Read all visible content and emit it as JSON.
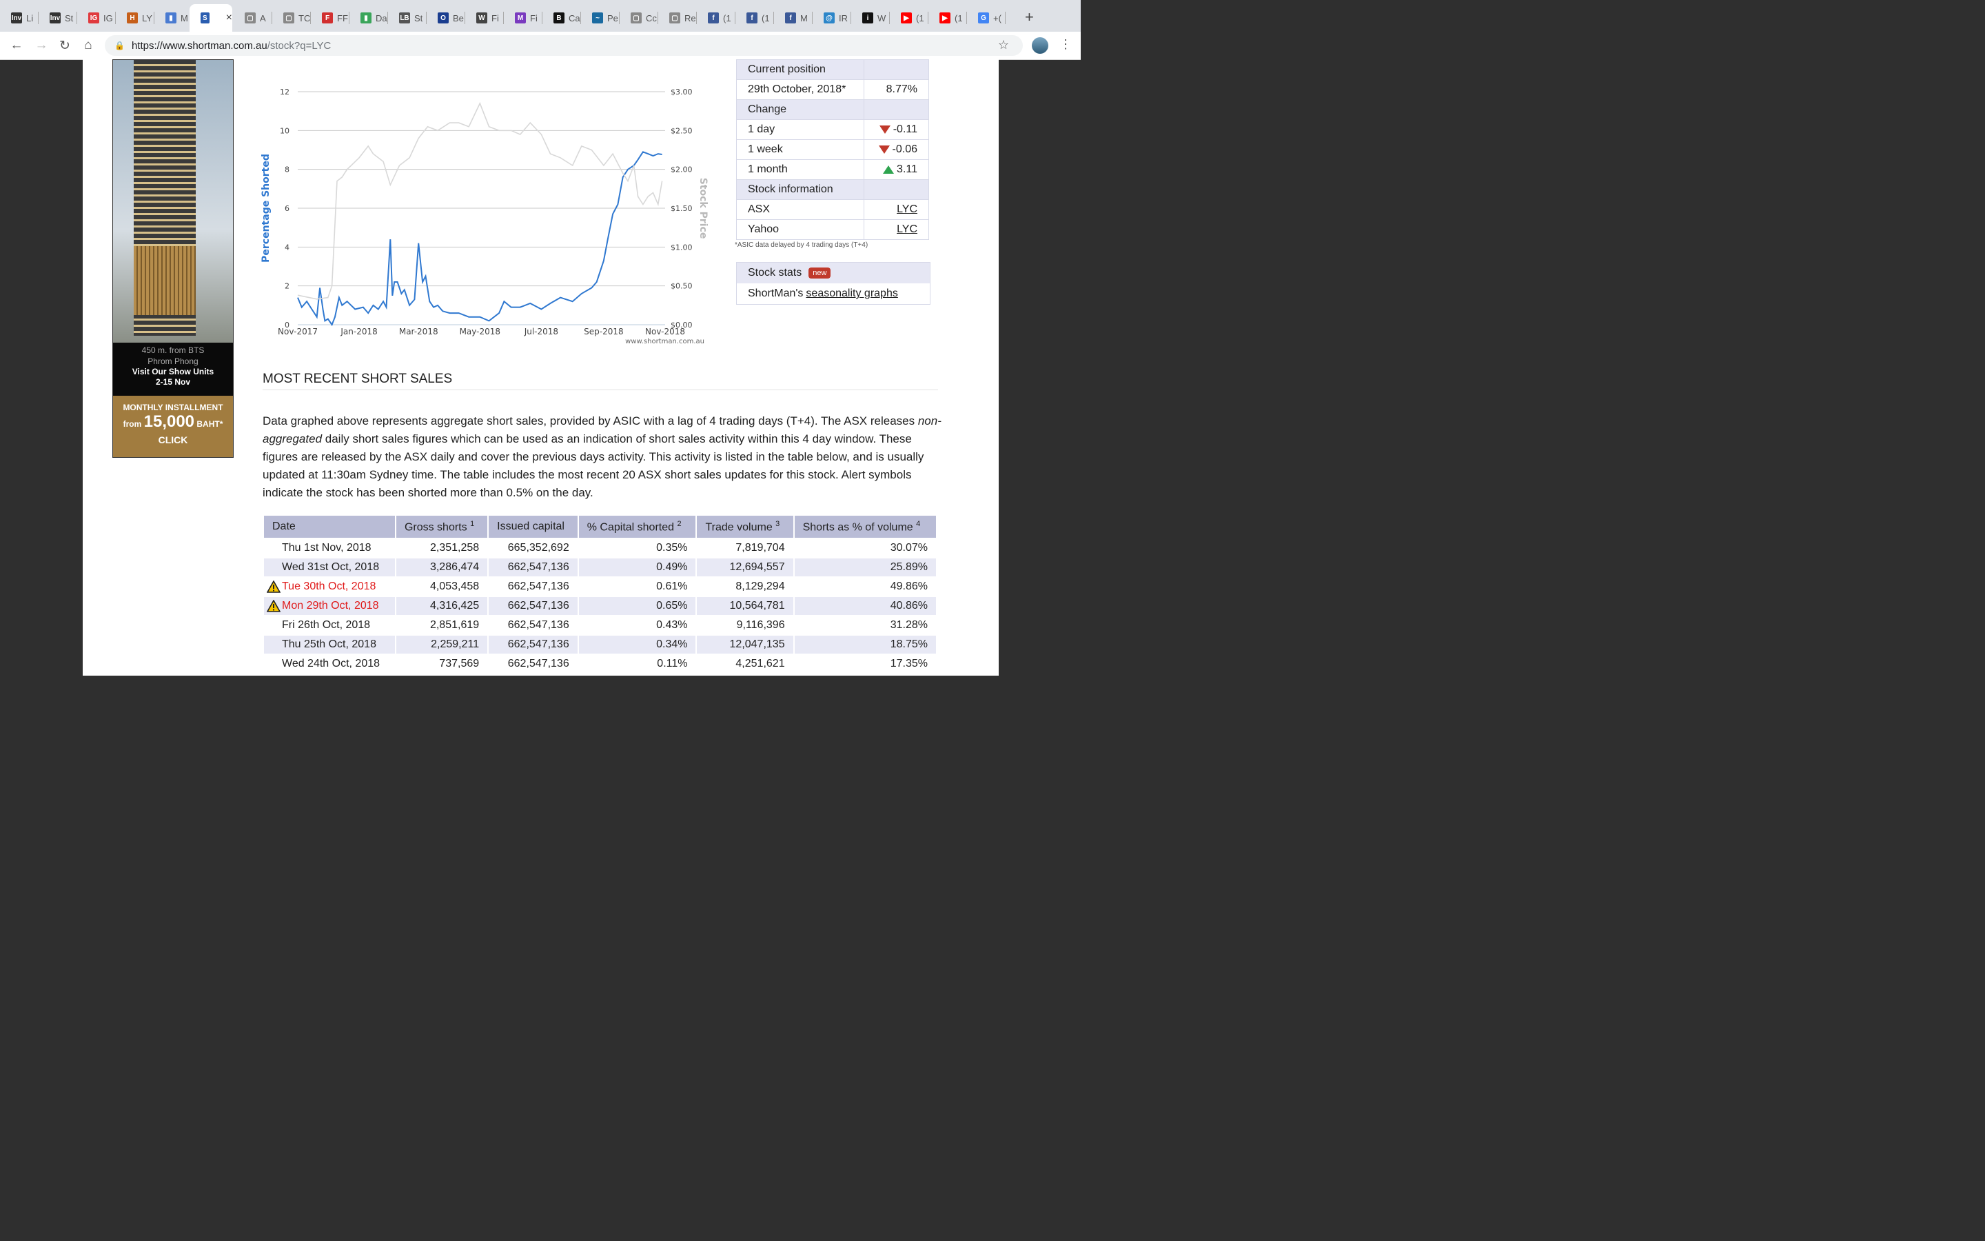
{
  "browser": {
    "tabs": [
      {
        "icon": "Inv",
        "label": "Li",
        "color": "#333"
      },
      {
        "icon": "Inv",
        "label": "St",
        "color": "#333"
      },
      {
        "icon": "IG",
        "label": "IG",
        "color": "#e03a3e"
      },
      {
        "icon": "H",
        "label": "LY",
        "color": "#c65f1a"
      },
      {
        "icon": "▮",
        "label": "M",
        "color": "#4a7bd1"
      },
      {
        "icon": "S",
        "label": "",
        "color": "#2a5db0",
        "active": true
      },
      {
        "icon": "▢",
        "label": "A",
        "color": "#888"
      },
      {
        "icon": "▢",
        "label": "TC",
        "color": "#888"
      },
      {
        "icon": "F",
        "label": "FF",
        "color": "#d12f2f"
      },
      {
        "icon": "▮",
        "label": "Da",
        "color": "#3aa55a"
      },
      {
        "icon": "LB",
        "label": "St",
        "color": "#555"
      },
      {
        "icon": "O",
        "label": "Be",
        "color": "#1a3d8f"
      },
      {
        "icon": "W",
        "label": "Fi",
        "color": "#444"
      },
      {
        "icon": "M",
        "label": "Fi",
        "color": "#7a3bbf"
      },
      {
        "icon": "B",
        "label": "Ca",
        "color": "#111"
      },
      {
        "icon": "~",
        "label": "Pe",
        "color": "#1a6aa0"
      },
      {
        "icon": "▢",
        "label": "Cc",
        "color": "#888"
      },
      {
        "icon": "▢",
        "label": "Re",
        "color": "#888"
      },
      {
        "icon": "f",
        "label": "(1",
        "color": "#3b5998"
      },
      {
        "icon": "f",
        "label": "(1",
        "color": "#3b5998"
      },
      {
        "icon": "f",
        "label": "M",
        "color": "#3b5998"
      },
      {
        "icon": "@",
        "label": "IR",
        "color": "#2c86c9"
      },
      {
        "icon": "i",
        "label": "W",
        "color": "#111"
      },
      {
        "icon": "▶",
        "label": "(1",
        "color": "#ff0000"
      },
      {
        "icon": "▶",
        "label": "(1",
        "color": "#ff0000"
      },
      {
        "icon": "G",
        "label": "+(",
        "color": "#4285f4"
      }
    ],
    "url_host": "https://www.shortman.com.au",
    "url_path": "/stock?q=LYC"
  },
  "ad": {
    "line1": "450 m. from BTS",
    "line2": "Phrom Phong",
    "line3": "Visit Our Show Units",
    "line4": "2-15 Nov",
    "installment_label": "MONTHLY INSTALLMENT",
    "from": "from",
    "amount": "15,000",
    "currency": "BAHT*",
    "cta": "CLICK"
  },
  "chart_data": {
    "type": "line",
    "title": "",
    "xlabel": "",
    "ylabel": "Percentage Shorted",
    "y2label": "Stock Price",
    "watermark": "www.shortman.com.au",
    "x_ticks": [
      "Nov-2017",
      "Jan-2018",
      "Mar-2018",
      "May-2018",
      "Jul-2018",
      "Sep-2018",
      "Nov-2018"
    ],
    "y_ticks": [
      "0",
      "2",
      "4",
      "6",
      "8",
      "10",
      "12"
    ],
    "y2_ticks": [
      "$0.00",
      "$0.50",
      "$1.00",
      "$1.50",
      "$2.00",
      "$2.50",
      "$3.00"
    ],
    "ylim": [
      0,
      12
    ],
    "y2lim": [
      0,
      3.0
    ],
    "xlim": [
      "2017-11-01",
      "2018-11-01"
    ],
    "series": [
      {
        "name": "Percentage Shorted",
        "axis": "left",
        "color": "#2f78d0",
        "x": [
          "2017-11-01",
          "2017-11-05",
          "2017-11-10",
          "2017-11-15",
          "2017-11-20",
          "2017-11-23",
          "2017-11-26",
          "2017-11-28",
          "2017-12-01",
          "2017-12-05",
          "2017-12-08",
          "2017-12-12",
          "2017-12-15",
          "2017-12-20",
          "2017-12-28",
          "2018-01-05",
          "2018-01-10",
          "2018-01-15",
          "2018-01-20",
          "2018-01-25",
          "2018-01-28",
          "2018-02-01",
          "2018-02-03",
          "2018-02-05",
          "2018-02-08",
          "2018-02-12",
          "2018-02-15",
          "2018-02-20",
          "2018-02-25",
          "2018-03-01",
          "2018-03-05",
          "2018-03-08",
          "2018-03-12",
          "2018-03-16",
          "2018-03-20",
          "2018-03-25",
          "2018-04-01",
          "2018-04-10",
          "2018-04-20",
          "2018-05-01",
          "2018-05-10",
          "2018-05-20",
          "2018-05-25",
          "2018-06-01",
          "2018-06-10",
          "2018-06-20",
          "2018-07-01",
          "2018-07-10",
          "2018-07-20",
          "2018-08-01",
          "2018-08-10",
          "2018-08-20",
          "2018-08-25",
          "2018-09-01",
          "2018-09-05",
          "2018-09-10",
          "2018-09-15",
          "2018-09-20",
          "2018-09-25",
          "2018-10-01",
          "2018-10-05",
          "2018-10-10",
          "2018-10-15",
          "2018-10-20",
          "2018-10-25",
          "2018-10-29"
        ],
        "y": [
          1.4,
          0.9,
          1.2,
          0.8,
          0.4,
          1.9,
          0.8,
          0.2,
          0.3,
          0.0,
          0.4,
          1.4,
          1.0,
          1.2,
          0.8,
          0.9,
          0.6,
          1.0,
          0.8,
          1.2,
          0.9,
          4.4,
          1.5,
          2.2,
          2.2,
          1.6,
          1.8,
          1.0,
          1.3,
          4.2,
          2.2,
          2.5,
          1.2,
          0.9,
          1.0,
          0.7,
          0.6,
          0.6,
          0.4,
          0.4,
          0.2,
          0.6,
          1.2,
          0.9,
          0.9,
          1.1,
          0.8,
          1.1,
          1.4,
          1.2,
          1.6,
          1.9,
          2.2,
          3.3,
          4.4,
          5.7,
          6.2,
          7.6,
          8.0,
          8.2,
          8.5,
          8.9,
          8.8,
          8.7,
          8.8,
          8.77
        ]
      },
      {
        "name": "Stock Price",
        "axis": "right",
        "color": "#d8d8d8",
        "x": [
          "2017-11-01",
          "2017-11-20",
          "2017-12-01",
          "2017-12-05",
          "2017-12-10",
          "2017-12-15",
          "2017-12-20",
          "2018-01-01",
          "2018-01-10",
          "2018-01-15",
          "2018-01-25",
          "2018-02-01",
          "2018-02-10",
          "2018-02-20",
          "2018-03-01",
          "2018-03-10",
          "2018-03-20",
          "2018-04-01",
          "2018-04-10",
          "2018-04-20",
          "2018-05-01",
          "2018-05-10",
          "2018-05-20",
          "2018-06-01",
          "2018-06-10",
          "2018-06-20",
          "2018-07-01",
          "2018-07-10",
          "2018-07-20",
          "2018-08-01",
          "2018-08-10",
          "2018-08-20",
          "2018-09-01",
          "2018-09-10",
          "2018-09-20",
          "2018-09-25",
          "2018-10-01",
          "2018-10-05",
          "2018-10-10",
          "2018-10-15",
          "2018-10-20",
          "2018-10-25",
          "2018-10-29"
        ],
        "y": [
          0.38,
          0.33,
          0.35,
          0.5,
          1.85,
          1.9,
          2.0,
          2.15,
          2.3,
          2.2,
          2.1,
          1.8,
          2.05,
          2.15,
          2.4,
          2.55,
          2.5,
          2.6,
          2.6,
          2.55,
          2.85,
          2.55,
          2.5,
          2.5,
          2.45,
          2.6,
          2.45,
          2.2,
          2.15,
          2.05,
          2.3,
          2.25,
          2.05,
          2.2,
          1.95,
          1.85,
          2.05,
          1.65,
          1.55,
          1.65,
          1.7,
          1.55,
          1.85
        ]
      }
    ]
  },
  "side_panel": {
    "current_position_label": "Current position",
    "date": "29th October, 2018*",
    "current_value": "8.77%",
    "change_label": "Change",
    "rows": [
      {
        "label": "1 day",
        "value": "-0.11",
        "dir": "down"
      },
      {
        "label": "1 week",
        "value": "-0.06",
        "dir": "down"
      },
      {
        "label": "1 month",
        "value": "3.11",
        "dir": "up"
      }
    ],
    "stock_info_label": "Stock information",
    "links": [
      {
        "label": "ASX",
        "value": "LYC"
      },
      {
        "label": "Yahoo",
        "value": "LYC"
      }
    ],
    "note": "*ASIC data delayed by 4 trading days (T+4)"
  },
  "stats": {
    "title": "Stock stats",
    "badge": "new",
    "text": "ShortMan's",
    "link": "seasonality graphs"
  },
  "section": {
    "heading": "MOST RECENT SHORT SALES",
    "para_1": "Data graphed above represents aggregate short sales, provided by ASIC with a lag of 4 trading days (T+4). The ASX releases",
    "para_em": "non-aggregated",
    "para_2": "daily short sales figures which can be used as an indication of short sales activity within this 4 day window. These figures are released by the ASX daily and cover the previous days activity. This activity is listed in the table below, and is usually updated at 11:30am Sydney time. The table includes the most recent 20 ASX short sales updates for this stock. Alert symbols indicate the stock has been shorted more than 0.5% on the day."
  },
  "table": {
    "headers": [
      {
        "label": "Date",
        "sup": ""
      },
      {
        "label": "Gross shorts",
        "sup": "1"
      },
      {
        "label": "Issued capital",
        "sup": ""
      },
      {
        "label": "% Capital shorted",
        "sup": "2"
      },
      {
        "label": "Trade volume",
        "sup": "3"
      },
      {
        "label": "Shorts as % of volume",
        "sup": "4"
      }
    ],
    "rows": [
      {
        "date": "Thu 1st Nov, 2018",
        "gross": "2,351,258",
        "issued": "665,352,692",
        "pct": "0.35%",
        "volume": "7,819,704",
        "share": "30.07%",
        "alert": false
      },
      {
        "date": "Wed 31st Oct, 2018",
        "gross": "3,286,474",
        "issued": "662,547,136",
        "pct": "0.49%",
        "volume": "12,694,557",
        "share": "25.89%",
        "alert": false
      },
      {
        "date": "Tue 30th Oct, 2018",
        "gross": "4,053,458",
        "issued": "662,547,136",
        "pct": "0.61%",
        "volume": "8,129,294",
        "share": "49.86%",
        "alert": true
      },
      {
        "date": "Mon 29th Oct, 2018",
        "gross": "4,316,425",
        "issued": "662,547,136",
        "pct": "0.65%",
        "volume": "10,564,781",
        "share": "40.86%",
        "alert": true
      },
      {
        "date": "Fri 26th Oct, 2018",
        "gross": "2,851,619",
        "issued": "662,547,136",
        "pct": "0.43%",
        "volume": "9,116,396",
        "share": "31.28%",
        "alert": false
      },
      {
        "date": "Thu 25th Oct, 2018",
        "gross": "2,259,211",
        "issued": "662,547,136",
        "pct": "0.34%",
        "volume": "12,047,135",
        "share": "18.75%",
        "alert": false
      },
      {
        "date": "Wed 24th Oct, 2018",
        "gross": "737,569",
        "issued": "662,547,136",
        "pct": "0.11%",
        "volume": "4,251,621",
        "share": "17.35%",
        "alert": false
      }
    ]
  }
}
